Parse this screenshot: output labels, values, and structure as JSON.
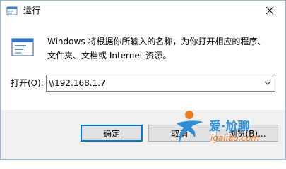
{
  "titlebar": {
    "title": "运行",
    "icon": "run-app-icon",
    "close_icon": "close-icon"
  },
  "main": {
    "icon": "run-app-icon",
    "description_line1": "Windows 将根据你所输入的名称，为你打开相应的程序、",
    "description_line2": "文件夹、文档或 Internet 资源。",
    "open_label": "打开(O):",
    "open_value": "\\\\192.168.1.7",
    "dropdown_icon": "chevron-down-icon"
  },
  "buttons": {
    "ok": "确定",
    "cancel": "取消",
    "browse": "浏览(B)..."
  },
  "watermark": {
    "brand": "爱·尬聊",
    "site": "igaliao.com"
  },
  "colors": {
    "focus_border": "#0078d7",
    "footer_bg": "#f0f0f0",
    "watermark_blue": "#2e8fd8",
    "watermark_orange": "#ee7a22"
  }
}
